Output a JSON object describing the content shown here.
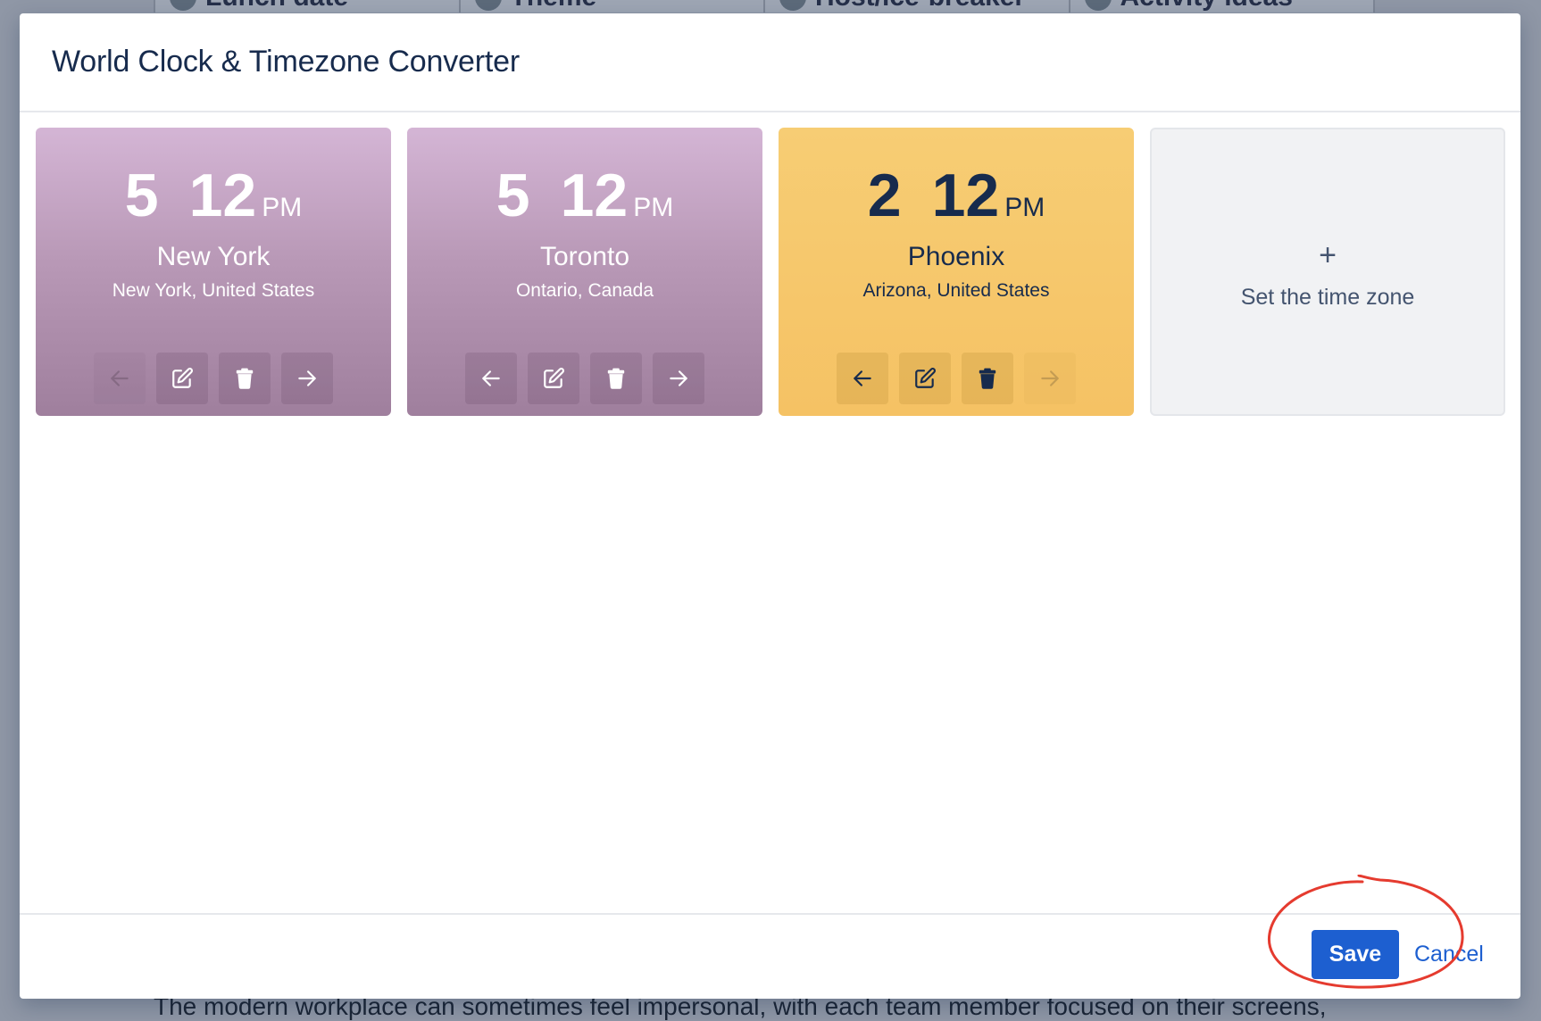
{
  "background": {
    "tabs": [
      {
        "label": "Lunch date"
      },
      {
        "label": "Theme"
      },
      {
        "label": "Host/ice-breaker"
      },
      {
        "label": "Activity ideas"
      }
    ],
    "paragraph": "The modern workplace can sometimes feel impersonal, with each team member focused on their screens,"
  },
  "modal": {
    "title": "World Clock & Timezone Converter",
    "clocks": [
      {
        "hour": "5",
        "minute": "12",
        "ampm": "PM",
        "city": "New York",
        "region": "New York, United States",
        "theme": "purple",
        "left_disabled": true,
        "right_disabled": false
      },
      {
        "hour": "5",
        "minute": "12",
        "ampm": "PM",
        "city": "Toronto",
        "region": "Ontario, Canada",
        "theme": "purple",
        "left_disabled": false,
        "right_disabled": false
      },
      {
        "hour": "2",
        "minute": "12",
        "ampm": "PM",
        "city": "Phoenix",
        "region": "Arizona, United States",
        "theme": "yellow",
        "left_disabled": false,
        "right_disabled": true
      }
    ],
    "add_card": {
      "plus": "+",
      "label": "Set the time zone"
    },
    "footer": {
      "save_label": "Save",
      "cancel_label": "Cancel"
    }
  },
  "colors": {
    "purple_card": "#b999b7",
    "yellow_card": "#f5c264",
    "primary_button": "#1d5fd0",
    "annotation": "#e53b2f"
  },
  "icons": [
    "arrow-left-icon",
    "edit-icon",
    "trash-icon",
    "arrow-right-icon",
    "plus-icon"
  ]
}
